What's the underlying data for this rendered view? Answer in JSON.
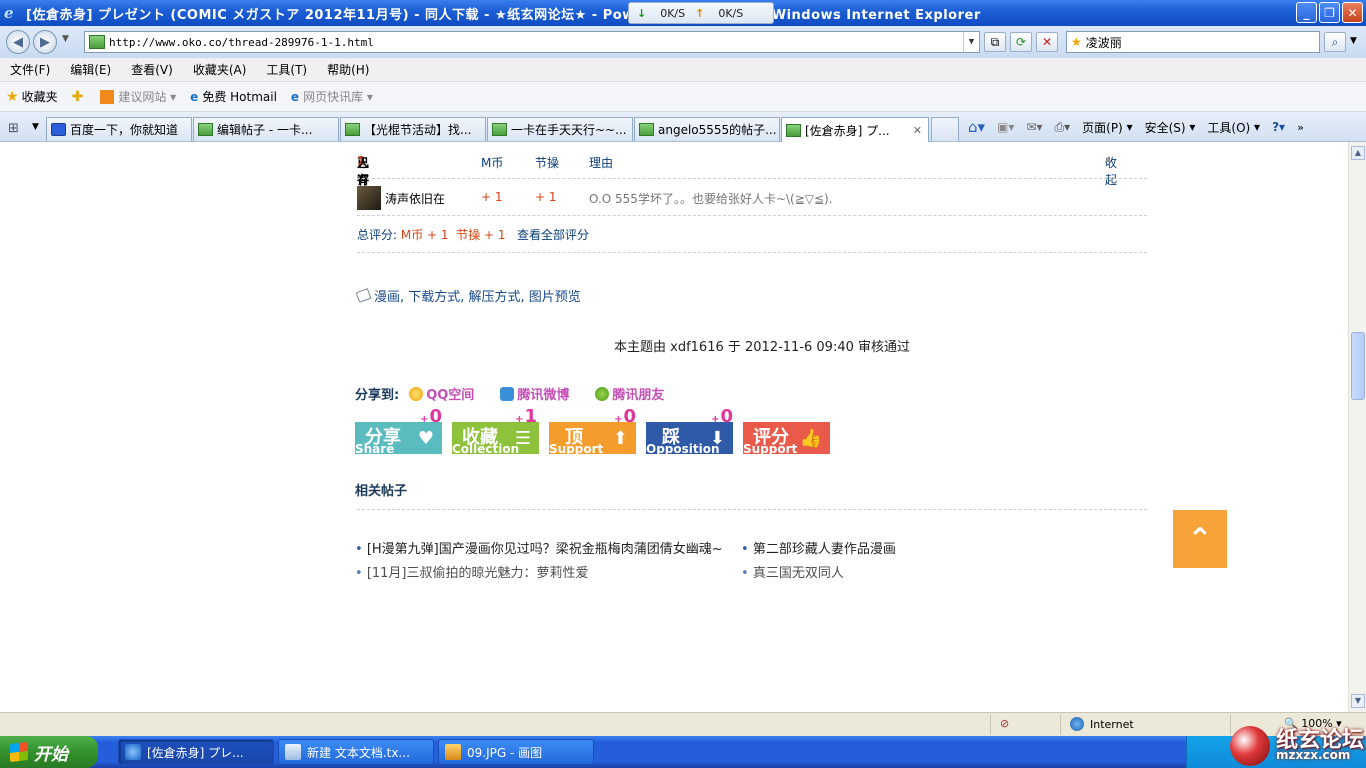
{
  "window": {
    "title": "[佐倉赤身] プレゼント (COMIC メガストア 2012年11月号) - 同人下载 - ★纸玄网论坛★ - Powered by Discuz! - Windows Internet Explorer",
    "speed_down": "0K/S",
    "speed_up": "0K/S"
  },
  "address": {
    "url": "http://www.oko.co/thread-289976-1-1.html",
    "search_text": "凌波丽"
  },
  "menu": [
    "文件(F)",
    "编辑(E)",
    "查看(V)",
    "收藏夹(A)",
    "工具(T)",
    "帮助(H)"
  ],
  "favorites": {
    "label": "收藏夹",
    "items": [
      "建议网站",
      "免费 Hotmail",
      "网页快讯库"
    ]
  },
  "tabs": [
    {
      "label": "百度一下，你就知道"
    },
    {
      "label": "编辑帖子 - 一卡..."
    },
    {
      "label": "【光棍节活动】找..."
    },
    {
      "label": "一卡在手天天行~~..."
    },
    {
      "label": "angelo5555的帖子..."
    },
    {
      "label": "[佐倉赤身] プ..."
    }
  ],
  "commands": {
    "page": "页面(P)",
    "safety": "安全(S)",
    "tools": "工具(O)"
  },
  "rating": {
    "header": {
      "prefix": "已有",
      "count": "1",
      "suffix": "人评分",
      "col1": "M币",
      "col2": "节操",
      "col3": "理由",
      "collapse": "收起"
    },
    "entries": [
      {
        "user": "涛声依旧在",
        "m": "+ 1",
        "jiecao": "+ 1",
        "reason": "O.O 555学坏了。。也要给张好人卡~\\(≧▽≦)."
      }
    ],
    "total_label": "总评分:",
    "total_m": "M币 + 1",
    "total_jiecao": "节操 + 1",
    "view_all": "查看全部评分"
  },
  "tags": "漫画, 下载方式, 解压方式, 图片预览",
  "review": "本主题由 xdf1616 于 2012-11-6 09:40 审核通过",
  "share": {
    "label": "分享到:",
    "items": [
      "QQ空间",
      "腾讯微博",
      "腾讯朋友"
    ]
  },
  "actions": [
    {
      "cn": "分享",
      "en": "Share",
      "count": "0",
      "color": "#5bbcc0"
    },
    {
      "cn": "收藏",
      "en": "Collection",
      "count": "1",
      "color": "#8fc23c"
    },
    {
      "cn": "顶",
      "en": "Support",
      "count": "0",
      "color": "#f59d2c"
    },
    {
      "cn": "踩",
      "en": "Opposition",
      "count": "0",
      "color": "#2e5aa8"
    },
    {
      "cn": "评分",
      "en": "Support",
      "count": "",
      "color": "#e95a4a"
    }
  ],
  "related": {
    "title": "相关帖子",
    "items": [
      "[H漫第九弹]国产漫画你见过吗？梁祝金瓶梅肉蒲团倩女幽魂~",
      "第二部珍藏人妻作品漫画",
      "[11月]三叔偷拍的晾光魅力：萝莉性爱",
      "真三国无双同人"
    ]
  },
  "status": {
    "zone": "Internet",
    "zoom": "100%"
  },
  "taskbar": {
    "start": "开始",
    "tasks": [
      "[佐倉赤身] プレ...",
      "新建 文本文档.tx...",
      "09.JPG - 画图"
    ]
  },
  "watermark": {
    "cn": "纸玄论坛",
    "site": "mzxzx.com"
  }
}
